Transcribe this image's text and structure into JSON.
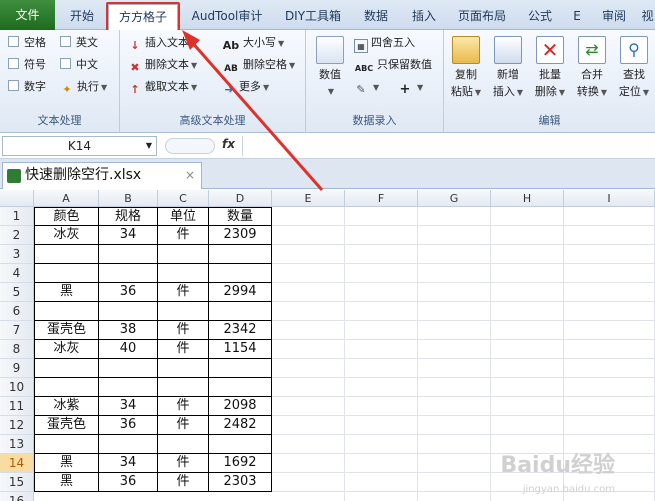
{
  "tabs": {
    "file": "文件",
    "items": [
      "开始",
      "方方格子",
      "AudTool审计",
      "DIY工具箱",
      "数据",
      "插入",
      "页面布局",
      "公式",
      "E",
      "审阅",
      "视"
    ]
  },
  "ribbon": {
    "text_proc": {
      "checkboxes": [
        "空格",
        "英文",
        "符号",
        "中文",
        "数字"
      ],
      "exec": "执行",
      "label": "文本处理"
    },
    "adv_text": {
      "insert": "插入文本",
      "delete": "删除文本",
      "cut": "截取文本",
      "case": "大小写",
      "del_space": "删除空格",
      "more": "更多",
      "label": "高级文本处理"
    },
    "num_entry": {
      "numeric": "数值",
      "round": "四舍五入",
      "keep_num": "只保留数值",
      "label": "数据录入"
    },
    "edit": {
      "copy_paste": [
        "复制",
        "粘贴"
      ],
      "add_insert": [
        "新增",
        "插入"
      ],
      "batch_delete": [
        "批量",
        "删除"
      ],
      "merge_convert": [
        "合并",
        "转换"
      ],
      "find_locate": [
        "查找",
        "定位"
      ],
      "label": "编辑"
    }
  },
  "formula_bar": {
    "name_box": "K14",
    "fx": "fx",
    "value": ""
  },
  "workbook": {
    "name": "快速删除空行.xlsx",
    "close": "×"
  },
  "sheet": {
    "columns": [
      "A",
      "B",
      "C",
      "D",
      "E",
      "F",
      "G",
      "H",
      "I"
    ],
    "rows": [
      {
        "n": "1",
        "a": "颜色",
        "b": "规格",
        "c": "单位",
        "d": "数量"
      },
      {
        "n": "2",
        "a": "冰灰",
        "b": "34",
        "c": "件",
        "d": "2309"
      },
      {
        "n": "3",
        "a": "",
        "b": "",
        "c": "",
        "d": ""
      },
      {
        "n": "4",
        "a": "",
        "b": "",
        "c": "",
        "d": ""
      },
      {
        "n": "5",
        "a": "黑",
        "b": "36",
        "c": "件",
        "d": "2994"
      },
      {
        "n": "6",
        "a": "",
        "b": "",
        "c": "",
        "d": ""
      },
      {
        "n": "7",
        "a": "蛋壳色",
        "b": "38",
        "c": "件",
        "d": "2342"
      },
      {
        "n": "8",
        "a": "冰灰",
        "b": "40",
        "c": "件",
        "d": "1154"
      },
      {
        "n": "9",
        "a": "",
        "b": "",
        "c": "",
        "d": ""
      },
      {
        "n": "10",
        "a": "",
        "b": "",
        "c": "",
        "d": ""
      },
      {
        "n": "11",
        "a": "冰紫",
        "b": "34",
        "c": "件",
        "d": "2098"
      },
      {
        "n": "12",
        "a": "蛋壳色",
        "b": "36",
        "c": "件",
        "d": "2482"
      },
      {
        "n": "13",
        "a": "",
        "b": "",
        "c": "",
        "d": ""
      },
      {
        "n": "14",
        "a": "黑",
        "b": "34",
        "c": "件",
        "d": "1692"
      },
      {
        "n": "15",
        "a": "黑",
        "b": "36",
        "c": "件",
        "d": "2303"
      },
      {
        "n": "16",
        "a": "",
        "b": "",
        "c": "",
        "d": ""
      }
    ]
  },
  "watermark": {
    "brand": "Baidu经验",
    "url": "jingyan.baidu.com"
  },
  "colors": {
    "file_tab": "#2e7d32",
    "highlight": "#e0302a",
    "selected_row": "#f9dca2"
  }
}
